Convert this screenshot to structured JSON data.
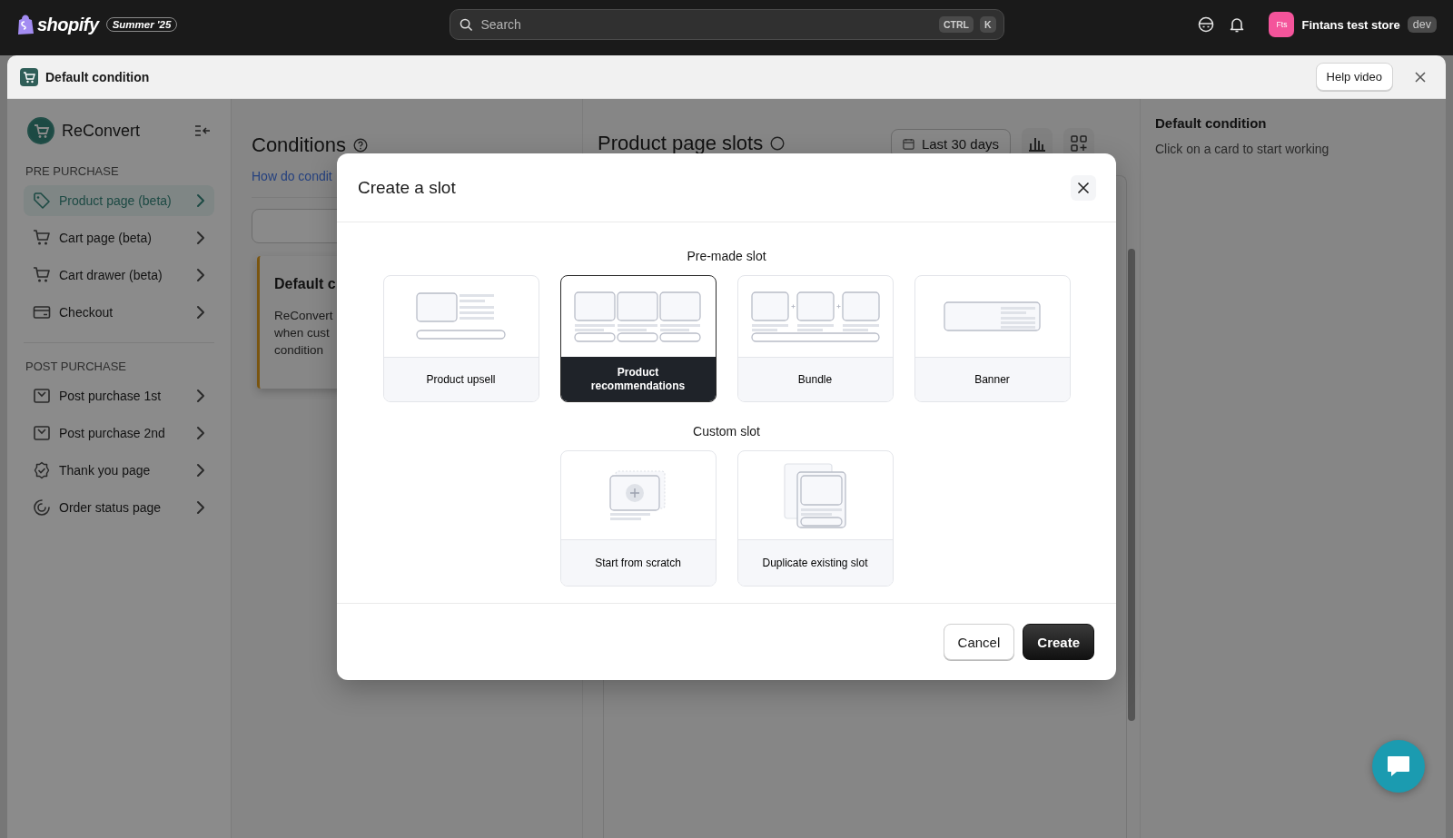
{
  "topbar": {
    "logo": "shopify",
    "edition_badge": "Summer '25",
    "search": {
      "placeholder": "Search"
    },
    "shortcut_keys": [
      "CTRL",
      "K"
    ],
    "store": {
      "avatar": "Fts",
      "name": "Fintans test store",
      "badge": "dev"
    }
  },
  "window": {
    "title": "Default condition",
    "help_button": "Help video"
  },
  "sidebar": {
    "app_name": "ReConvert",
    "sections": [
      {
        "title": "PRE PURCHASE",
        "items": [
          {
            "label": "Product page (beta)",
            "selected": true
          },
          {
            "label": "Cart page (beta)",
            "selected": false
          },
          {
            "label": "Cart drawer (beta)",
            "selected": false
          },
          {
            "label": "Checkout",
            "selected": false
          }
        ]
      },
      {
        "title": "POST PURCHASE",
        "items": [
          {
            "label": "Post purchase 1st",
            "selected": false
          },
          {
            "label": "Post purchase 2nd",
            "selected": false
          },
          {
            "label": "Thank you page",
            "selected": false
          },
          {
            "label": "Order status page",
            "selected": false
          }
        ]
      }
    ]
  },
  "conditions": {
    "title": "Conditions",
    "link": "How do condit",
    "card": {
      "title": "Default c",
      "description_lines": [
        "ReConvert",
        "when cust",
        "condition"
      ]
    }
  },
  "slots_panel": {
    "title": "Product page slots",
    "date_range": "Last 30 days"
  },
  "details_panel": {
    "title": "Default condition",
    "hint": "Click on a card to start working"
  },
  "modal": {
    "title": "Create a slot",
    "sections": [
      {
        "title": "Pre-made slot",
        "options": [
          {
            "label": "Product upsell",
            "kind": "upsell",
            "selected": false
          },
          {
            "label": "Product recommendations",
            "kind": "recommendations",
            "selected": true
          },
          {
            "label": "Bundle",
            "kind": "bundle",
            "selected": false
          },
          {
            "label": "Banner",
            "kind": "banner",
            "selected": false
          }
        ]
      },
      {
        "title": "Custom slot",
        "options": [
          {
            "label": "Start from scratch",
            "kind": "scratch",
            "selected": false
          },
          {
            "label": "Duplicate existing slot",
            "kind": "duplicate",
            "selected": false
          }
        ]
      }
    ],
    "buttons": [
      {
        "label": "Cancel",
        "kind": "secondary"
      },
      {
        "label": "Create",
        "kind": "primary"
      }
    ]
  }
}
